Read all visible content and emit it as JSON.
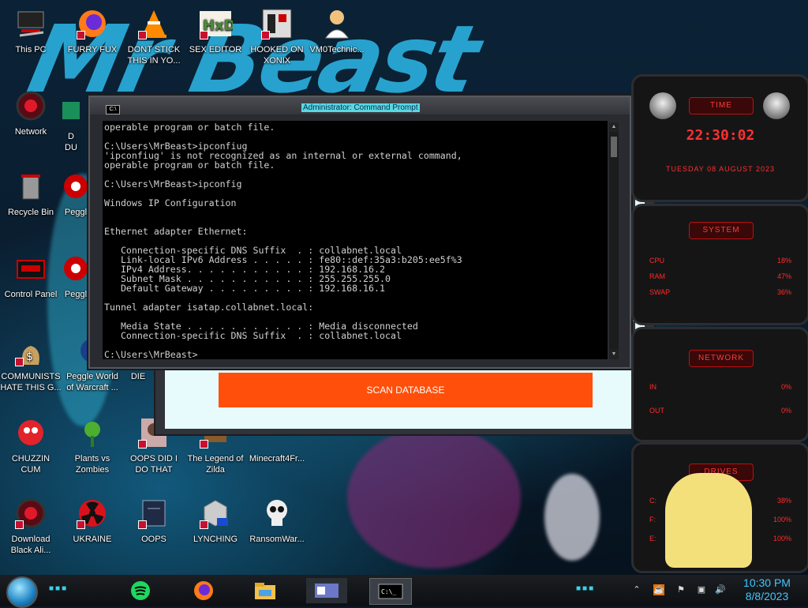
{
  "desktop": {
    "icons": [
      {
        "label": "This PC",
        "icon": "computer-icon"
      },
      {
        "label": "FURRY FUX",
        "icon": "firefox-icon"
      },
      {
        "label": "DONT STICK\nTHIS IN YO...",
        "icon": "vlc-cone-icon"
      },
      {
        "label": "SEX EDITOR",
        "icon": "hxd-editor-icon"
      },
      {
        "label": "HOOKED ON\nXONIX",
        "icon": "xonix-game-icon"
      },
      {
        "label": "VM0Technic...",
        "icon": "doctor-icon"
      },
      {
        "label": "Network",
        "icon": "network-globe-icon"
      },
      {
        "label": "D\nDU",
        "icon": "partial-icon"
      },
      {
        "label": "Recycle Bin",
        "icon": "recycle-bin-icon"
      },
      {
        "label": "Peggl",
        "icon": "peggle-icon"
      },
      {
        "label": "Control Panel",
        "icon": "control-panel-icon"
      },
      {
        "label": "Peggl",
        "icon": "peggle-icon"
      },
      {
        "label": "COMMUNISTS\nHATE THIS G...",
        "icon": "money-bag-icon"
      },
      {
        "label": "Peggle World\nof Warcraft ...",
        "icon": "peggle-icon"
      },
      {
        "label": "DIE",
        "icon": "partial-icon"
      },
      {
        "label": "CHUZZIN\nCUM",
        "icon": "chuzzle-icon"
      },
      {
        "label": "Plants vs\nZombies",
        "icon": "plant-icon"
      },
      {
        "label": "OOPS DID I\nDO THAT",
        "icon": "photo-icon"
      },
      {
        "label": "The Legend of\nZilda",
        "icon": "game-icon"
      },
      {
        "label": "Minecraft4Fr...",
        "icon": "minecraft-icon"
      },
      {
        "label": "Download\nBlack Ali...",
        "icon": "alien-globe-icon"
      },
      {
        "label": "UKRAINE",
        "icon": "radiation-icon"
      },
      {
        "label": "OOPS",
        "icon": "terminal-file-icon"
      },
      {
        "label": "LYNCHING",
        "icon": "network-folder-icon"
      },
      {
        "label": "RansomWar...",
        "icon": "skull-icon"
      }
    ]
  },
  "wallpaper": {
    "banner_text": "Mr Beast"
  },
  "cmd": {
    "title": "Administrator: Command Prompt",
    "icon_label": "C:\\",
    "output": "operable program or batch file.\n\nC:\\Users\\MrBeast>ipconfiug\n'ipconfiug' is not recognized as an internal or external command,\noperable program or batch file.\n\nC:\\Users\\MrBeast>ipconfig\n\nWindows IP Configuration\n\n\nEthernet adapter Ethernet:\n\n   Connection-specific DNS Suffix  . : collabnet.local\n   Link-local IPv6 Address . . . . . : fe80::def:35a3:b205:ee5f%3\n   IPv4 Address. . . . . . . . . . . : 192.168.16.2\n   Subnet Mask . . . . . . . . . . . : 255.255.255.0\n   Default Gateway . . . . . . . . . : 192.168.16.1\n\nTunnel adapter isatap.collabnet.local:\n\n   Media State . . . . . . . . . . . : Media disconnected\n   Connection-specific DNS Suffix  . : collabnet.local\n\nC:\\Users\\MrBeast>_"
  },
  "app": {
    "scan_button": "SCAN DATABASE"
  },
  "widgets": {
    "time": {
      "header": "TIME",
      "clock": "22:30:02",
      "date": "TUESDAY 08 AUGUST 2023"
    },
    "system": {
      "header": "SYSTEM",
      "rows": [
        {
          "k": "CPU",
          "v": "18%"
        },
        {
          "k": "RAM",
          "v": "47%"
        },
        {
          "k": "SWAP",
          "v": "36%"
        }
      ]
    },
    "network": {
      "header": "NETWORK",
      "rows": [
        {
          "k": "IN",
          "v": "0%"
        },
        {
          "k": "OUT",
          "v": "0%"
        }
      ]
    },
    "drives": {
      "header": "DRIVES",
      "rows": [
        {
          "k": "C:",
          "v": "38%"
        },
        {
          "k": "F:",
          "v": "100%"
        },
        {
          "k": "E:",
          "v": "100%"
        }
      ]
    }
  },
  "taskbar": {
    "apps": [
      "spotify-icon",
      "firefox-icon",
      "file-explorer-icon",
      "id-card-app-icon",
      "command-prompt-icon"
    ],
    "tray": [
      "chevron-up-icon",
      "java-icon",
      "flag-icon",
      "network-icon",
      "volume-icon"
    ],
    "time": "10:30 PM",
    "date": "8/8/2023"
  }
}
